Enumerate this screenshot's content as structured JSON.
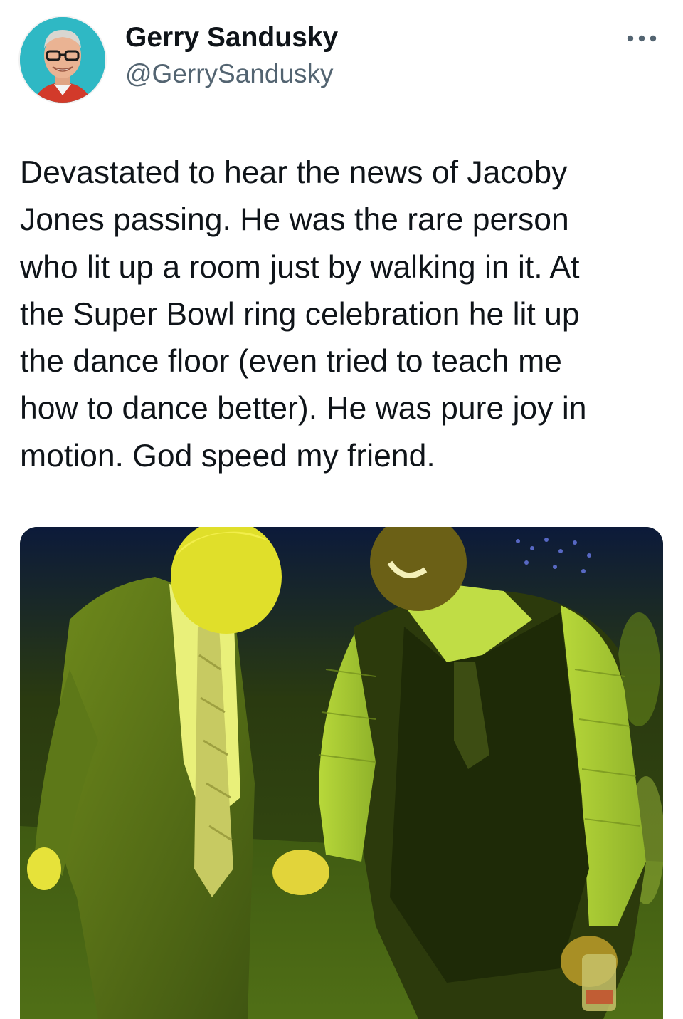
{
  "author": {
    "display_name": "Gerry Sandusky",
    "handle": "@GerrySandusky"
  },
  "icons": {
    "more": "more-horizontal-icon"
  },
  "tweet": {
    "text": "Devastated to hear the news of Jacoby\nJones passing. He was the rare person\nwho lit up a room just by walking in it. At\nthe Super Bowl ring celebration he lit up\nthe dance floor (even tried to teach me\nhow to dance better). He was pure joy in\nmotion. God speed my friend."
  },
  "colors": {
    "text": "#0f1419",
    "secondary": "#536471",
    "avatar_bg": "#2fb8c4",
    "photo_tint": "#c8e23a"
  }
}
